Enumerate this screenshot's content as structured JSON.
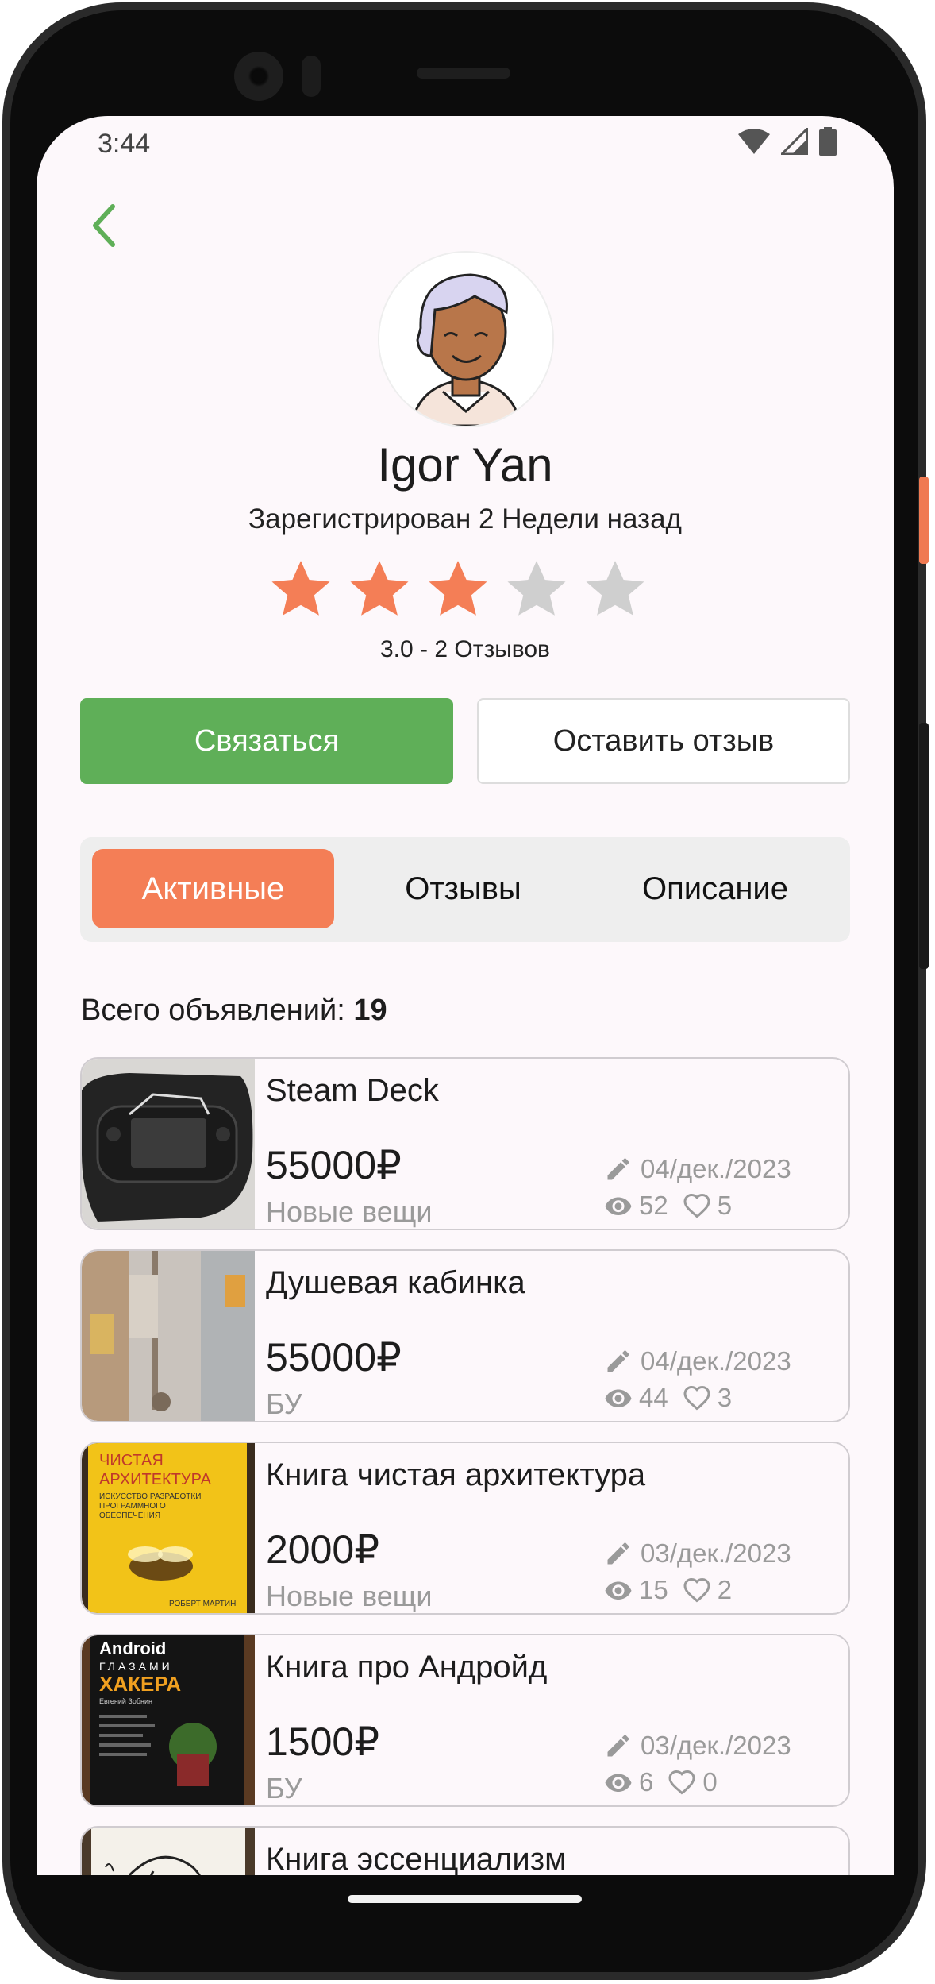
{
  "status_bar": {
    "time": "3:44"
  },
  "profile": {
    "name": "Igor Yan",
    "registered": "Зарегистрирован 2 Недели назад",
    "rating_value": 3.0,
    "rating_max": 5,
    "rating_text": "3.0 - 2 Отзывов"
  },
  "actions": {
    "contact_label": "Связаться",
    "review_label": "Оставить отзыв"
  },
  "tabs": [
    {
      "label": "Активные"
    },
    {
      "label": "Отзывы"
    },
    {
      "label": "Описание"
    }
  ],
  "listings_summary": {
    "label": "Всего объявлений:",
    "count": "19"
  },
  "listings": [
    {
      "title": "Steam Deck",
      "price": "55000₽",
      "condition": "Новые вещи",
      "date": "04/дек./2023",
      "views": "52",
      "likes": "5"
    },
    {
      "title": "Душевая кабинка",
      "price": "55000₽",
      "condition": "БУ",
      "date": "04/дек./2023",
      "views": "44",
      "likes": "3"
    },
    {
      "title": "Книга чистая архитектура",
      "price": "2000₽",
      "condition": "Новые вещи",
      "date": "03/дек./2023",
      "views": "15",
      "likes": "2"
    },
    {
      "title": "Книга про Андройд",
      "price": "1500₽",
      "condition": "БУ",
      "date": "03/дек./2023",
      "views": "6",
      "likes": "0"
    },
    {
      "title": "Книга эссенциализм",
      "price": "",
      "condition": "",
      "date": "",
      "views": "",
      "likes": ""
    }
  ],
  "thumb_text": {
    "book1_line1": "ЧИСТАЯ",
    "book1_line2": "АРХИТЕКТУРА",
    "book1_sub1": "ИСКУССТВО РАЗРАБОТКИ",
    "book1_sub2": "ПРОГРАММНОГО",
    "book1_sub3": "ОБЕСПЕЧЕНИЯ",
    "book1_author": "РОБЕРТ МАРТИН",
    "book2_line1": "Android",
    "book2_line2": "ГЛАЗАМИ",
    "book2_line3": "ХАКЕРА",
    "book2_author": "Евгений Зобнин"
  },
  "icons": {
    "back": "chevron-left-icon",
    "wifi": "wifi-icon",
    "signal": "signal-icon",
    "battery": "battery-icon",
    "edit": "pencil-icon",
    "views": "eye-icon",
    "likes": "heart-icon",
    "star": "star-icon"
  },
  "colors": {
    "accent_green": "#5faf58",
    "accent_orange": "#f47e56",
    "star_filled": "#f47e56",
    "star_empty": "#cfcfcf",
    "muted_text": "#9a9a9a"
  }
}
